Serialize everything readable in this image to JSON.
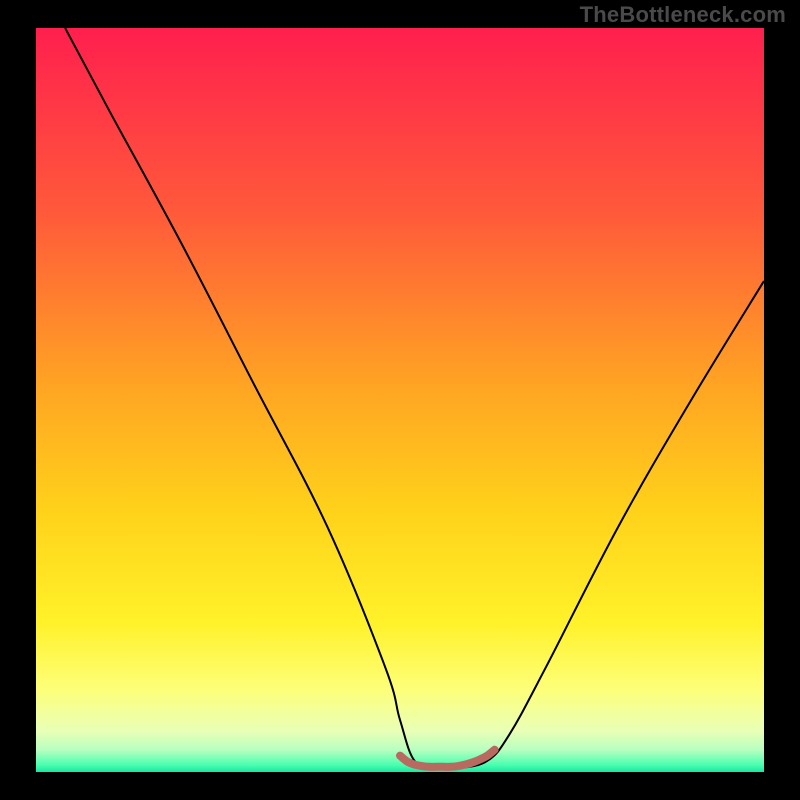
{
  "watermark": {
    "text": "TheBottleneck.com"
  },
  "colors": {
    "frame_background": "#000000",
    "watermark_text": "#4a4a4a",
    "gradient_stops": [
      {
        "offset": 0.0,
        "color": "#ff1f4e"
      },
      {
        "offset": 0.25,
        "color": "#ff5a3a"
      },
      {
        "offset": 0.48,
        "color": "#ffa423"
      },
      {
        "offset": 0.65,
        "color": "#ffd21a"
      },
      {
        "offset": 0.8,
        "color": "#fff22a"
      },
      {
        "offset": 0.89,
        "color": "#fdff7a"
      },
      {
        "offset": 0.945,
        "color": "#e9ffb6"
      },
      {
        "offset": 0.97,
        "color": "#b8ffc0"
      },
      {
        "offset": 0.99,
        "color": "#4dffb0"
      },
      {
        "offset": 1.0,
        "color": "#18e8a1"
      }
    ],
    "curve_stroke": "#000000",
    "bottom_band_stroke": "#b86a60"
  },
  "chart_data": {
    "type": "line",
    "title": "",
    "xlabel": "",
    "ylabel": "",
    "xlim": [
      0,
      100
    ],
    "ylim": [
      0,
      100
    ],
    "series": [
      {
        "name": "v-curve",
        "x": [
          4,
          10,
          20,
          30,
          40,
          48,
          50,
          52,
          55,
          58,
          62,
          65,
          70,
          80,
          90,
          100
        ],
        "y": [
          100,
          89,
          71,
          52,
          33,
          14,
          7,
          1.5,
          0.5,
          0.5,
          1.5,
          5,
          14,
          33,
          50,
          66
        ]
      },
      {
        "name": "bottom-band",
        "x": [
          50,
          51,
          52,
          53,
          54,
          55,
          56,
          57,
          58,
          59,
          60,
          61,
          62,
          63
        ],
        "y": [
          2.2,
          1.4,
          1.0,
          0.8,
          0.7,
          0.7,
          0.7,
          0.7,
          0.8,
          1.0,
          1.3,
          1.7,
          2.2,
          3.0
        ]
      }
    ],
    "background": "vertical-gradient"
  }
}
